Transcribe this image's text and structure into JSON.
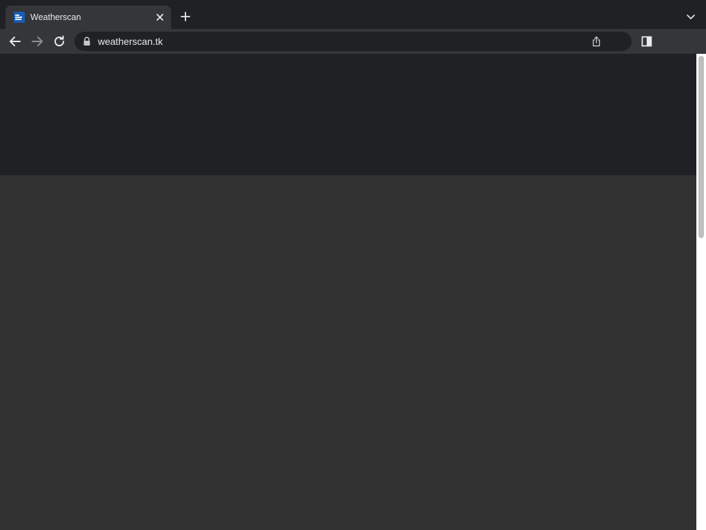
{
  "tab": {
    "title": "Weatherscan",
    "favicon": "the-weather-channel-favicon",
    "close_icon": "close-icon"
  },
  "tabstrip": {
    "new_tab_icon": "plus-icon",
    "tab_search_icon": "chevron-down-icon"
  },
  "toolbar": {
    "back_icon": "arrow-left-icon",
    "forward_icon": "arrow-right-icon",
    "reload_icon": "reload-icon",
    "security_icon": "lock-icon",
    "url": "weatherscan.tk",
    "share_icon": "share-icon",
    "side_panel_icon": "side-panel-icon"
  },
  "colors": {
    "tabstrip_bg": "#202124",
    "toolbar_bg": "#35363a",
    "omnibox_bg": "#202124",
    "page_header_bg": "#202124",
    "page_bg": "#323232",
    "favicon_bg": "#1a5bb3"
  }
}
